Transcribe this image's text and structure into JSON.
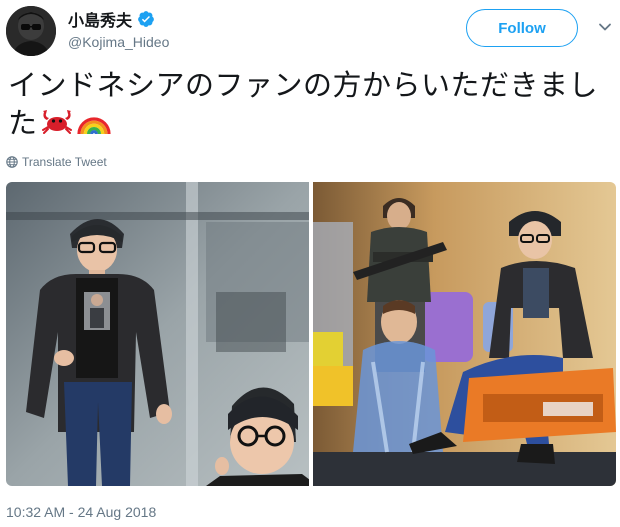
{
  "author": {
    "display_name": "小島秀夫",
    "handle": "@Kojima_Hideo",
    "avatar_icon": "avatar-photo",
    "verified_icon": "verified-badge-icon"
  },
  "actions": {
    "follow_label": "Follow",
    "more_icon": "chevron-down-icon"
  },
  "tweet": {
    "text": "インドネシアのファンの方からいただきました",
    "emojis": [
      "crab-emoji",
      "rainbow-emoji"
    ],
    "translate_label": "Translate Tweet",
    "timestamp": "10:32 AM - 24 Aug 2018"
  },
  "media": {
    "photos": [
      "photo-figure-standing",
      "photo-figure-group"
    ]
  },
  "colors": {
    "accent": "#1da1f2",
    "secondary_text": "#657786",
    "primary_text": "#14171a"
  }
}
